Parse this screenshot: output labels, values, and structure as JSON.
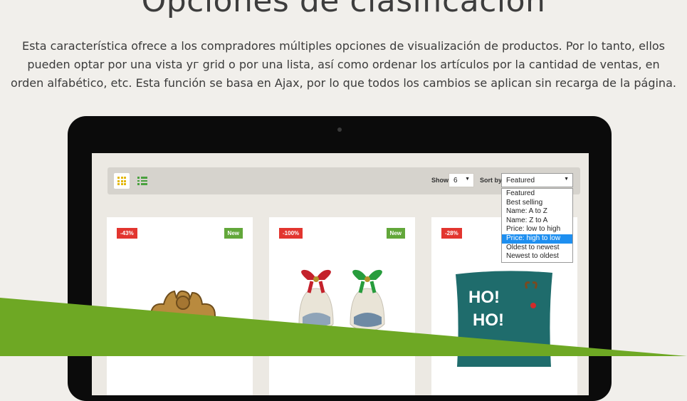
{
  "heading": "Opciones de clasificación",
  "description": "Esta característica ofrece a los compradores múltiples opciones de visualización de productos. Por lo tanto, ellos pueden optar por una vista уг grid o por una lista, así como ordenar los artículos por la cantidad de ventas, en orden alfabético, etc. Esta función se basa en Ajax, por lo que todos los cambios se aplican sin recarga de la página.",
  "toolbar": {
    "grid_icon": "grid-view-icon",
    "list_icon": "list-view-icon",
    "show_label": "Show",
    "show_value": "6",
    "sort_label": "Sort by",
    "sort_value": "Featured",
    "sort_options": [
      "Featured",
      "Best selling",
      "Name: A to Z",
      "Name: Z to A",
      "Price: low to high",
      "Price: high to low",
      "Oldest to newest",
      "Newest to oldest"
    ],
    "highlighted_option": "Price: high to low"
  },
  "products": [
    {
      "discount": "-43%",
      "badge": "New"
    },
    {
      "discount": "-100%",
      "badge": "New"
    },
    {
      "discount": "-28%"
    }
  ],
  "pillow_text": [
    "HO!",
    "HO!"
  ],
  "colors": {
    "background": "#f1efeb",
    "accent_green": "#6ea824",
    "discount_red": "#e2352f",
    "new_green": "#62a73a",
    "highlight_blue": "#1e8ff0"
  }
}
